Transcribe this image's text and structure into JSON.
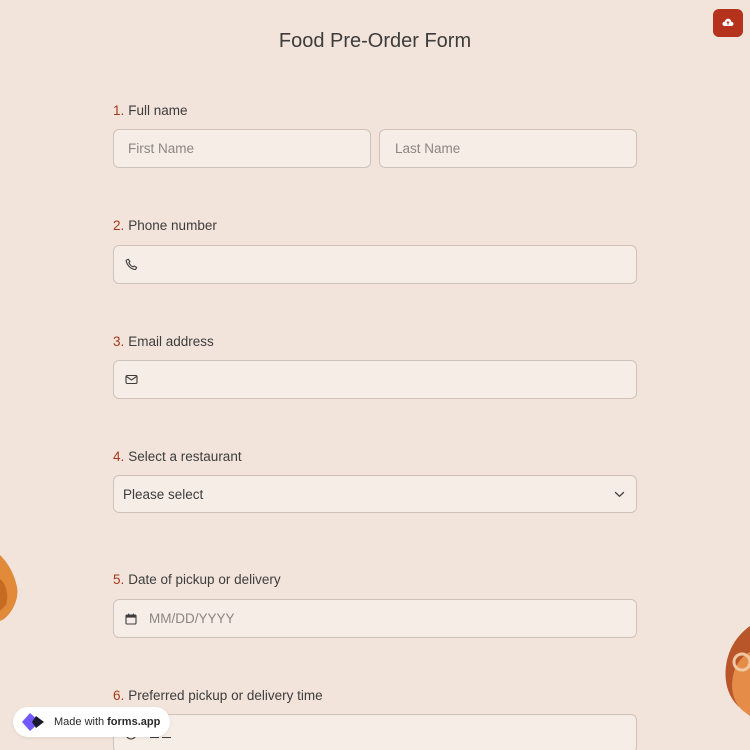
{
  "form": {
    "title": "Food Pre-Order Form"
  },
  "questions": [
    {
      "number": "1.",
      "label": "Full name",
      "first_placeholder": "First Name",
      "last_placeholder": "Last Name"
    },
    {
      "number": "2.",
      "label": "Phone number",
      "icon": "phone-icon",
      "value": ""
    },
    {
      "number": "3.",
      "label": "Email address",
      "icon": "mail-icon",
      "value": ""
    },
    {
      "number": "4.",
      "label": "Select a restaurant",
      "selected": "Please select",
      "icon": "chevron-down-icon"
    },
    {
      "number": "5.",
      "label": "Date of pickup or delivery",
      "placeholder": "MM/DD/YYYY",
      "icon": "calendar-icon"
    },
    {
      "number": "6.",
      "label": "Preferred pickup or delivery time",
      "icon": "clock-icon"
    }
  ],
  "footer": {
    "made_with": "Made with",
    "brand": "forms.app"
  },
  "colors": {
    "background": "#f2e4db",
    "accent": "#b5321c",
    "number": "#a33a1d",
    "field_bg": "#f6ede7"
  },
  "icons": {
    "save": "cloud-upload-icon",
    "badge": "forms-app-logo-icon"
  }
}
